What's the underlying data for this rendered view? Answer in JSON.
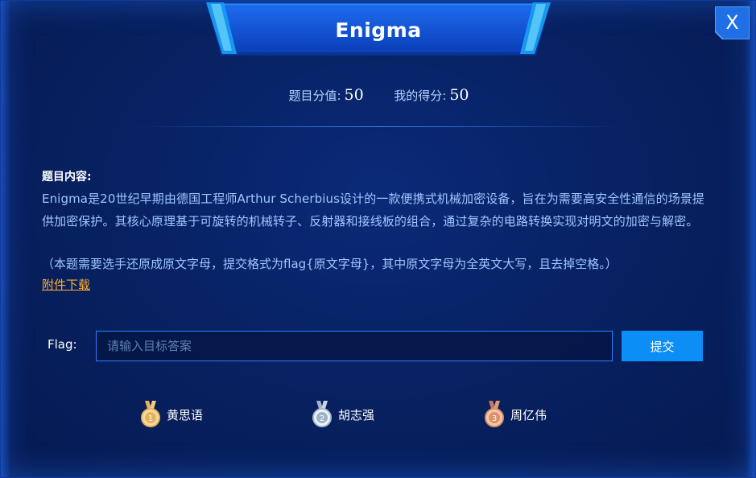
{
  "dialog": {
    "title": "Enigma",
    "close_label": "X"
  },
  "score": {
    "value_label": "题目分值:",
    "value": "50",
    "my_label": "我的得分:",
    "my": "50"
  },
  "content": {
    "label": "题目内容:",
    "description": "Enigma是20世纪早期由德国工程师Arthur Scherbius设计的一款便携式机械加密设备，旨在为需要高安全性通信的场景提供加密保护。其核心原理基于可旋转的机械转子、反射器和接线板的组合，通过复杂的电路转换实现对明文的加密与解密。",
    "note": "（本题需要选手还原成原文字母，提交格式为flag{原文字母}，其中原文字母为全英文大写，且去掉空格。）",
    "download": "附件下载"
  },
  "flag": {
    "label": "Flag:",
    "placeholder": "请输入目标答案",
    "value": "",
    "submit": "提交"
  },
  "winners": [
    {
      "rank": "1",
      "name": "黄思语",
      "medal_color": "#e8b25a"
    },
    {
      "rank": "2",
      "name": "胡志强",
      "medal_color": "#c9d6e6"
    },
    {
      "rank": "3",
      "name": "周亿伟",
      "medal_color": "#d9926a"
    }
  ],
  "colors": {
    "accent": "#0b8ef5",
    "link": "#ffb02e",
    "text_blue": "#9fc6ff",
    "background": "#07205f"
  }
}
